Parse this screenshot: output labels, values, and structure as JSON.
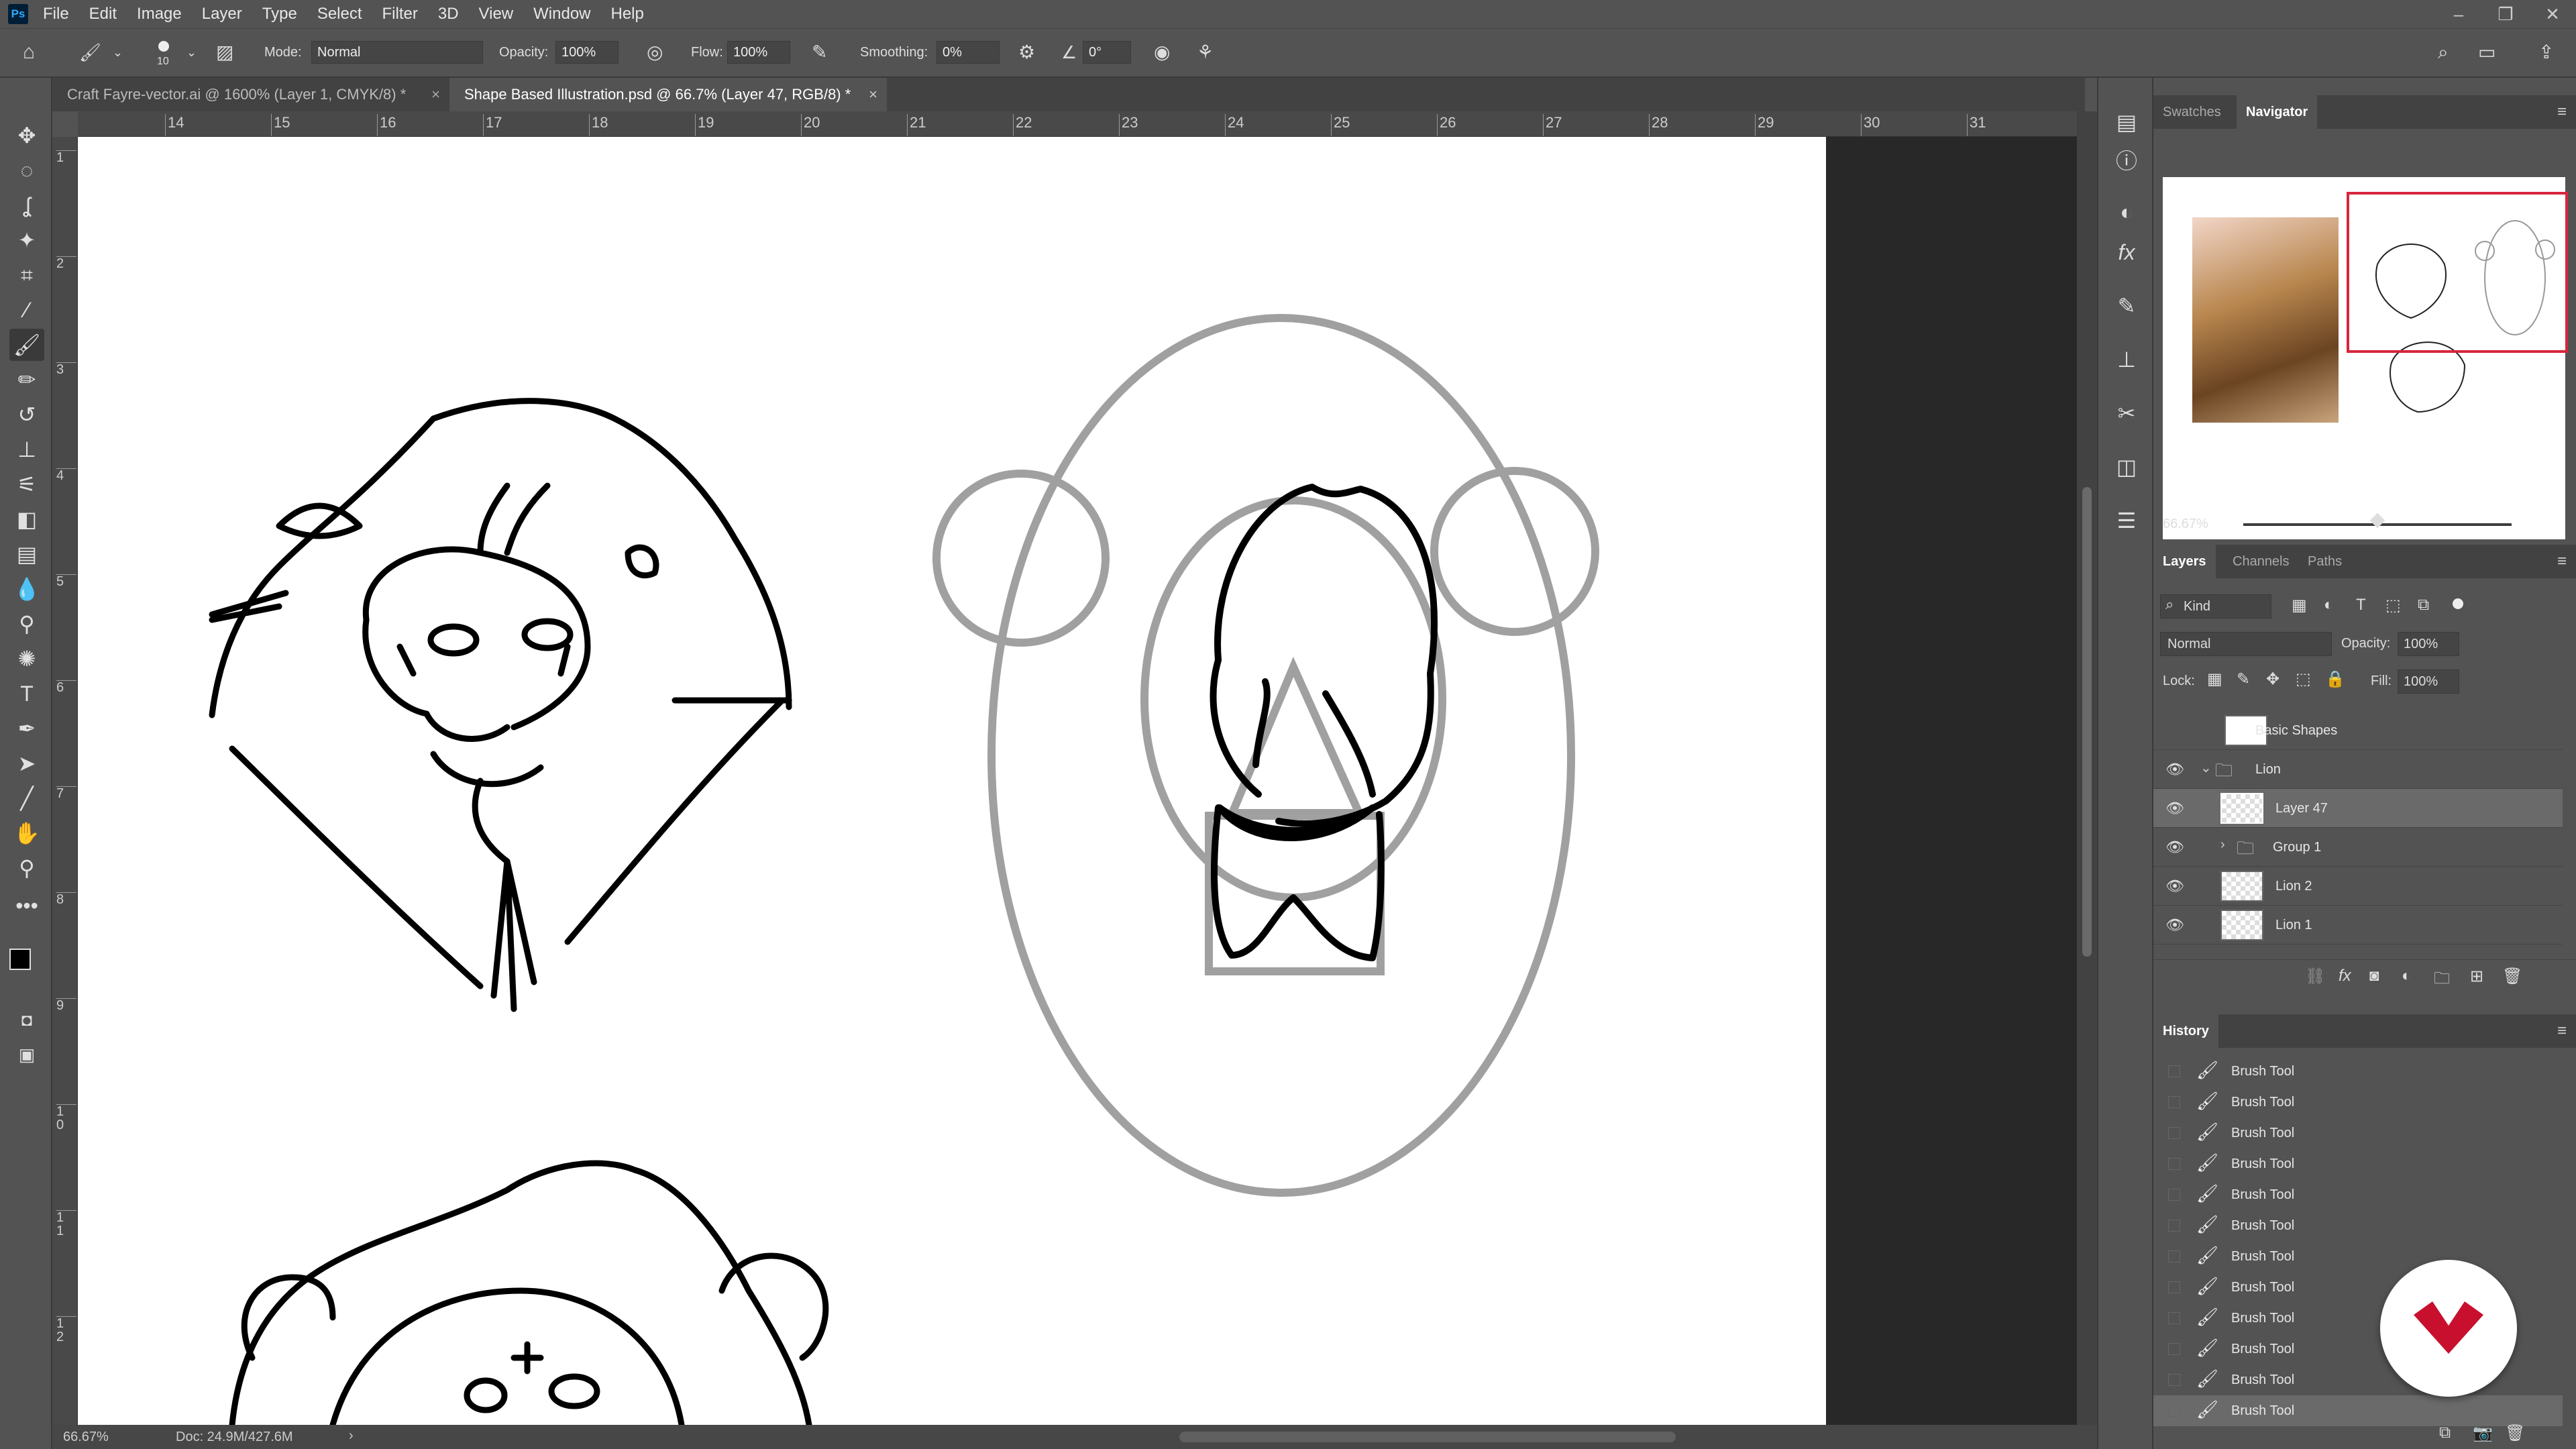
{
  "app": {
    "logo": "Ps"
  },
  "menu": [
    "File",
    "Edit",
    "Image",
    "Layer",
    "Type",
    "Select",
    "Filter",
    "3D",
    "View",
    "Window",
    "Help"
  ],
  "window_controls": [
    "–",
    "❐",
    "✕"
  ],
  "options": {
    "brush_size": "10",
    "mode_label": "Mode:",
    "mode_value": "Normal",
    "opacity_label": "Opacity:",
    "opacity_value": "100%",
    "flow_label": "Flow:",
    "flow_value": "100%",
    "smoothing_label": "Smoothing:",
    "smoothing_value": "0%",
    "angle_value": "0°"
  },
  "tabs": [
    {
      "label": "Craft Fayre-vector.ai @ 1600% (Layer 1, CMYK/8) *",
      "close": "×"
    },
    {
      "label": "Shape Based Illustration.psd @ 66.7% (Layer 47, RGB/8) *",
      "close": "×"
    }
  ],
  "hruler_ticks": [
    "14",
    "15",
    "16",
    "17",
    "18",
    "19",
    "20",
    "21",
    "22",
    "23",
    "24",
    "25",
    "26",
    "27",
    "28",
    "29",
    "30",
    "31"
  ],
  "vruler_ticks": [
    "1",
    "2",
    "3",
    "4",
    "5",
    "6",
    "7",
    "8",
    "9",
    "1\n0",
    "1\n1",
    "1\n2"
  ],
  "status": {
    "zoom": "66.67%",
    "doc": "Doc: 24.9M/427.6M",
    "arrow": "›"
  },
  "panels": {
    "top_tabs": [
      "Swatches",
      "Navigator"
    ],
    "nav_zoom": "66.67%",
    "layers_tabs": [
      "Layers",
      "Channels",
      "Paths"
    ],
    "filter_kind": "Kind",
    "blend_mode": "Normal",
    "opacity_label": "Opacity:",
    "opacity_value": "100%",
    "lock_label": "Lock:",
    "fill_label": "Fill:",
    "fill_value": "100%",
    "layers": [
      {
        "name": "Basic Shapes",
        "visible": false,
        "type": "layer"
      },
      {
        "name": "Lion",
        "visible": true,
        "type": "group-open"
      },
      {
        "name": "Layer 47",
        "visible": true,
        "type": "layer",
        "selected": true
      },
      {
        "name": "Group 1",
        "visible": true,
        "type": "group"
      },
      {
        "name": "Lion 2",
        "visible": true,
        "type": "layer"
      },
      {
        "name": "Lion 1",
        "visible": true,
        "type": "layer"
      }
    ],
    "history_title": "History",
    "history": [
      "Brush Tool",
      "Brush Tool",
      "Brush Tool",
      "Brush Tool",
      "Brush Tool",
      "Brush Tool",
      "Brush Tool",
      "Brush Tool",
      "Brush Tool",
      "Brush Tool",
      "Brush Tool",
      "Brush Tool"
    ]
  },
  "colors": {
    "accent": "#31a8ff",
    "nav_frame": "#d7263d",
    "badge": "#c8102e"
  }
}
